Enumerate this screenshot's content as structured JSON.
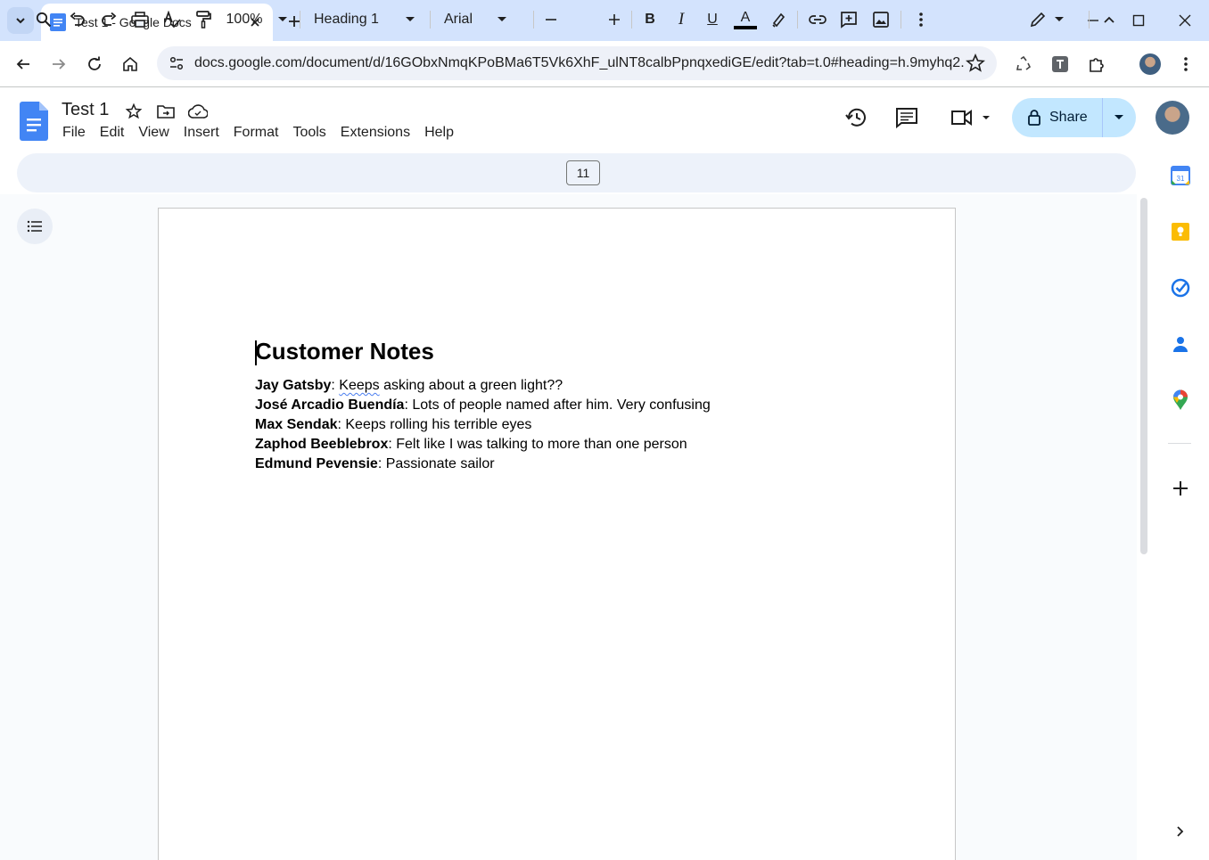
{
  "browser": {
    "tab_title": "Test 1 - Google Docs",
    "url": "docs.google.com/document/d/16GObxNmqKPoBMa6T5Vk6XhF_ulNT8calbPpnqxediGE/edit?tab=t.0#heading=h.9myhq2..."
  },
  "docs": {
    "title": "Test 1",
    "menu": [
      "File",
      "Edit",
      "View",
      "Insert",
      "Format",
      "Tools",
      "Extensions",
      "Help"
    ],
    "share_label": "Share",
    "toolbar": {
      "zoom": "100%",
      "style": "Heading 1",
      "font": "Arial",
      "font_size": "11",
      "bold": "B",
      "italic": "I",
      "underline": "U",
      "text_color": "A"
    }
  },
  "document": {
    "heading": "Customer Notes",
    "entries": [
      {
        "name": "Jay Gatsby",
        "note_misspelled": "Keeps",
        "note": " asking about a green light??"
      },
      {
        "name": "José Arcadio Buendía",
        "note": ": Lots of people named after him. Very confusing"
      },
      {
        "name": "Max Sendak",
        "note": ": Keeps rolling his terrible eyes"
      },
      {
        "name": "Zaphod Beeblebrox",
        "note": ": Felt like I was talking to more than one person"
      },
      {
        "name": "Edmund Pevensie",
        "note": ": Passionate sailor"
      }
    ]
  },
  "colors": {
    "accent": "#0b57d0",
    "share_bg": "#c2e7ff",
    "toolbar_bg": "#edf2fa",
    "tabbar_bg": "#d3e3fd"
  }
}
